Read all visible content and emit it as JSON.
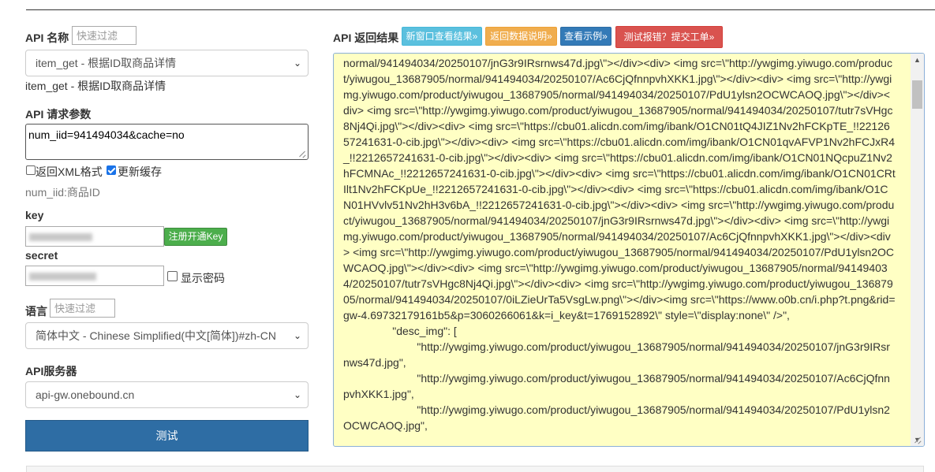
{
  "api_name": {
    "label": "API 名称",
    "filter_placeholder": "快速过滤",
    "selected": "item_get - 根据ID取商品详情",
    "desc": "item_get - 根据ID取商品详情"
  },
  "params": {
    "label": "API 请求参数",
    "value": "num_iid=941494034&cache=no",
    "xml_label": "返回XML格式",
    "xml_checked": false,
    "cache_label": "更新缓存",
    "cache_checked": true,
    "hint": "num_iid:商品ID"
  },
  "key": {
    "label": "key",
    "register_button": "注册开通Key"
  },
  "secret": {
    "label": "secret",
    "show_password_label": "显示密码",
    "show_password_checked": false
  },
  "language": {
    "label": "语言",
    "filter_placeholder": "快速过滤",
    "selected": "简体中文 - Chinese Simplified(中文[简体])#zh-CN"
  },
  "server": {
    "label": "API服务器",
    "selected": "api-gw.onebound.cn"
  },
  "test_button": "测试",
  "result": {
    "label": "API 返回结果",
    "buttons": {
      "new_window": "新窗口查看结果»",
      "doc": "返回数据说明»",
      "example": "查看示例»",
      "report": "测试报错？提交工单»"
    },
    "colors": {
      "new_window": "#5bc0de",
      "doc": "#f0ad4e",
      "example": "#337ab7",
      "report": "#d9534f"
    },
    "text": "normal/941494034/20250107/jnG3r9IRsrnws47d.jpg\\\"></div><div> <img src=\\\"http://ywgimg.yiwugo.com/product/yiwugou_13687905/normal/941494034/20250107/Ac6CjQfnnpvhXKK1.jpg\\\"></div><div> <img src=\\\"http://ywgimg.yiwugo.com/product/yiwugou_13687905/normal/941494034/20250107/PdU1ylsn2OCWCAOQ.jpg\\\"></div><div> <img src=\\\"http://ywgimg.yiwugo.com/product/yiwugou_13687905/normal/941494034/20250107/tutr7sVHgc8Nj4Qi.jpg\\\"></div><div> <img src=\\\"https://cbu01.alicdn.com/img/ibank/O1CN01tQ4JIZ1Nv2hFCKpTE_!!2212657241631-0-cib.jpg\\\"></div><div> <img src=\\\"https://cbu01.alicdn.com/img/ibank/O1CN01qvAFVP1Nv2hFCJxR4_!!2212657241631-0-cib.jpg\\\"></div><div> <img src=\\\"https://cbu01.alicdn.com/img/ibank/O1CN01NQcpuZ1Nv2hFCMNAc_!!2212657241631-0-cib.jpg\\\"></div><div> <img src=\\\"https://cbu01.alicdn.com/img/ibank/O1CN01CRtIlt1Nv2hFCKpUe_!!2212657241631-0-cib.jpg\\\"></div><div> <img src=\\\"https://cbu01.alicdn.com/img/ibank/O1CN01HVvlv51Nv2hH3v6bA_!!2212657241631-0-cib.jpg\\\"></div><div> <img src=\\\"http://ywgimg.yiwugo.com/product/yiwugou_13687905/normal/941494034/20250107/jnG3r9IRsrnws47d.jpg\\\"></div><div> <img src=\\\"http://ywgimg.yiwugo.com/product/yiwugou_13687905/normal/941494034/20250107/Ac6CjQfnnpvhXKK1.jpg\\\"></div><div> <img src=\\\"http://ywgimg.yiwugo.com/product/yiwugou_13687905/normal/941494034/20250107/PdU1ylsn2OCWCAOQ.jpg\\\"></div><div> <img src=\\\"http://ywgimg.yiwugo.com/product/yiwugou_13687905/normal/941494034/20250107/tutr7sVHgc8Nj4Qi.jpg\\\"></div><div> <img src=\\\"http://ywgimg.yiwugo.com/product/yiwugou_13687905/normal/941494034/20250107/0iLZieUrTa5VsgLw.png\\\"></div><img src=\\\"https://www.o0b.cn/i.php?t.png&rid=gw-4.69732179161b5&p=3060266061&k=i_key&t=1769152892\\\" style=\\\"display:none\\\" />\",\n                \"desc_img\": [\n                        \"http://ywgimg.yiwugo.com/product/yiwugou_13687905/normal/941494034/20250107/jnG3r9IRsrnws47d.jpg\",\n                        \"http://ywgimg.yiwugo.com/product/yiwugou_13687905/normal/941494034/20250107/Ac6CjQfnnpvhXKK1.jpg\",\n                        \"http://ywgimg.yiwugo.com/product/yiwugou_13687905/normal/941494034/20250107/PdU1ylsn2OCWCAOQ.jpg\","
  }
}
